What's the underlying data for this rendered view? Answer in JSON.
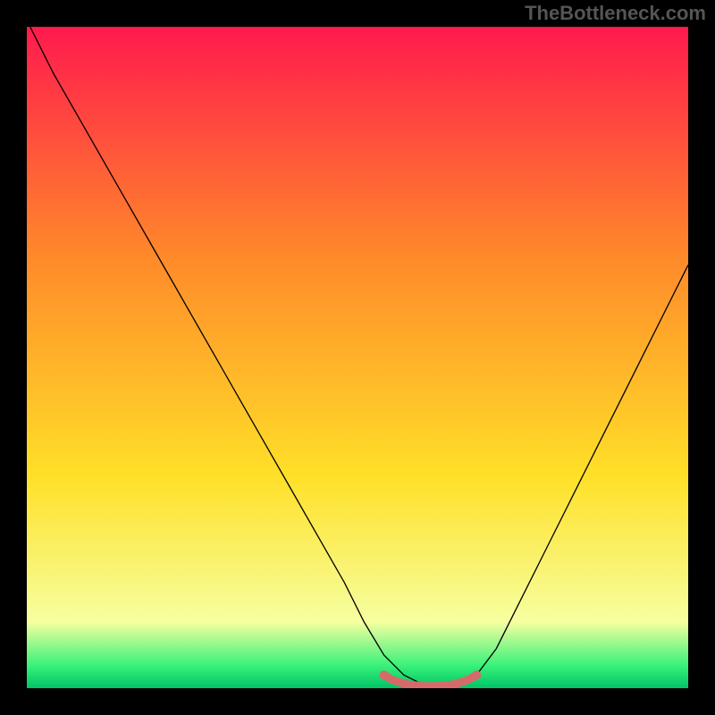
{
  "watermark": "TheBottleneck.com",
  "chart_data": {
    "type": "line",
    "title": "",
    "xlabel": "",
    "ylabel": "",
    "xlim": [
      0,
      100
    ],
    "ylim": [
      0,
      100
    ],
    "grid": false,
    "legend": false,
    "background_gradient": {
      "top_color": "#ff1a4d",
      "mid_color_1": "#ff8a2a",
      "mid_color_2": "#ffe028",
      "bottom_color_1": "#f6ffa0",
      "bottom_color_2": "#3bf27a",
      "bottom_color_3": "#00c466"
    },
    "series": [
      {
        "name": "bottleneck-curve",
        "color": "#000000",
        "stroke_width": 1.3,
        "x": [
          0.5,
          4,
          8,
          12,
          16,
          20,
          24,
          28,
          32,
          36,
          40,
          44,
          48,
          51,
          54,
          57,
          60,
          62,
          64,
          66,
          68,
          71,
          74,
          78,
          82,
          86,
          90,
          94,
          98,
          100
        ],
        "values": [
          100,
          93,
          86,
          79,
          72,
          65,
          58,
          51,
          44,
          37,
          30,
          23,
          16,
          10,
          5,
          2,
          0.5,
          0.3,
          0.3,
          0.5,
          2,
          6,
          12,
          20,
          28,
          36,
          44,
          52,
          60,
          64
        ]
      },
      {
        "name": "baseline-marker",
        "color": "#d66a6a",
        "stroke_width": 9,
        "x": [
          54,
          55,
          56,
          57,
          58,
          59,
          60,
          61,
          62,
          63,
          64,
          65,
          66,
          67,
          68
        ],
        "values": [
          2.0,
          1.4,
          1.0,
          0.7,
          0.5,
          0.4,
          0.3,
          0.3,
          0.3,
          0.4,
          0.5,
          0.7,
          1.0,
          1.4,
          2.0
        ]
      }
    ],
    "marker_endpoints": {
      "left": {
        "x": 54,
        "y": 2.0
      },
      "right": {
        "x": 68,
        "y": 2.0
      },
      "radius": 5,
      "color": "#d66a6a"
    }
  }
}
